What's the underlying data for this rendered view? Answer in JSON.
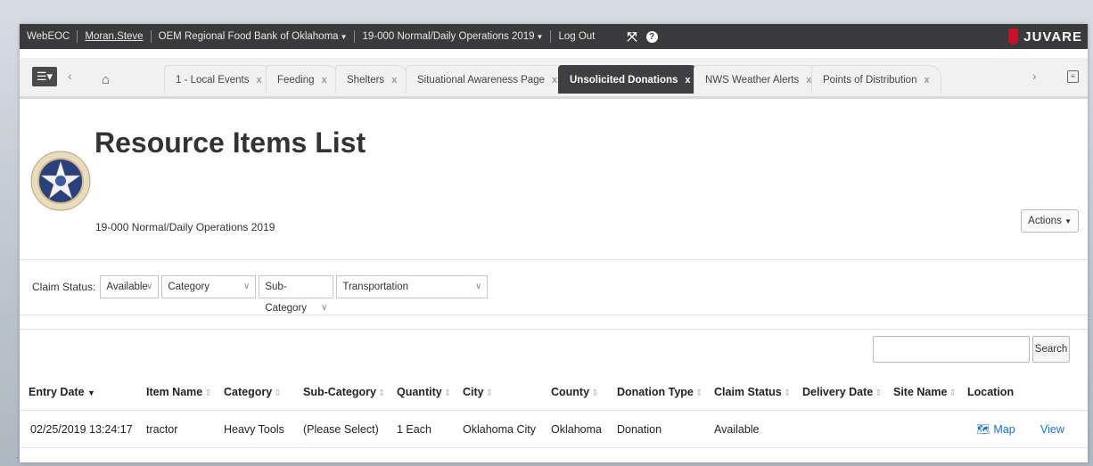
{
  "topbar": {
    "app": "WebEOC",
    "user": "Moran.Steve",
    "position": "OEM Regional Food Bank of Oklahoma",
    "incident": "19-000 Normal/Daily Operations 2019",
    "logout": "Log Out",
    "brand": "JUVARE"
  },
  "tabs": [
    {
      "label": "1 - Local Events"
    },
    {
      "label": "Feeding"
    },
    {
      "label": "Shelters"
    },
    {
      "label": "Situational Awareness Page"
    },
    {
      "label": "Unsolicited Donations",
      "active": true
    },
    {
      "label": "NWS Weather Alerts"
    },
    {
      "label": "Points of Distribution"
    }
  ],
  "header": {
    "title": "Resource Items List",
    "subtitle": "19-000 Normal/Daily Operations 2019",
    "actions_label": "Actions"
  },
  "filters": {
    "label": "Claim Status:",
    "claim_status": "Available",
    "category": "Category",
    "sub_category": "Sub-Category",
    "sub_category_value": "Transportation"
  },
  "search": {
    "button": "Search",
    "value": ""
  },
  "table": {
    "headers": [
      "Entry Date",
      "Item Name",
      "Category",
      "Sub-Category",
      "Quantity",
      "City",
      "County",
      "Donation Type",
      "Claim Status",
      "Delivery Date",
      "Site Name",
      "Location"
    ],
    "rows": [
      {
        "entry_date": "02/25/2019 13:24:17",
        "item_name": "tractor",
        "category": "Heavy Tools",
        "sub_category": "(Please Select)",
        "quantity": "1 Each",
        "city": "Oklahoma City",
        "county": "Oklahoma",
        "donation_type": "Donation",
        "claim_status": "Available",
        "delivery_date": "",
        "site_name": "",
        "location_link": "Map",
        "view_link": "View"
      }
    ]
  },
  "colors": {
    "topbar": "#3a3a3c",
    "active_tab": "#3f3f41",
    "link": "#1f6fbf",
    "brand_mark": "#c8102e"
  }
}
